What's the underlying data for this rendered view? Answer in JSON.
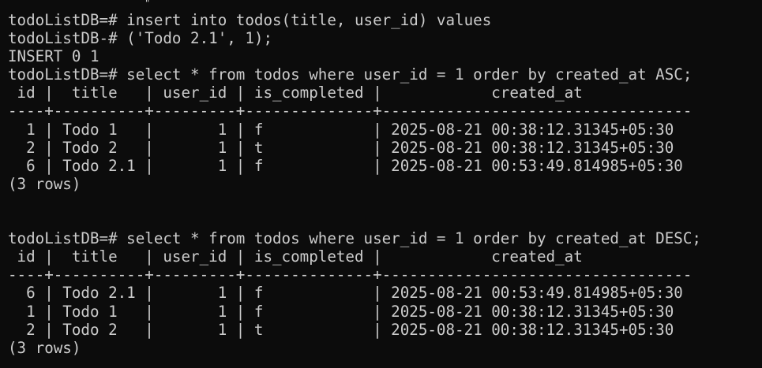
{
  "terminal": {
    "background": "#0c0c0c",
    "foreground": "#cccccc",
    "top_fragment": "\"",
    "lines": [
      "todoListDB=# insert into todos(title, user_id) values",
      "todoListDB-# ('Todo 2.1', 1);",
      "INSERT 0 1",
      "todoListDB=# select * from todos where user_id = 1 order by created_at ASC;",
      " id |  title   | user_id | is_completed |            created_at",
      "----+----------+---------+--------------+----------------------------------",
      "  1 | Todo 1   |       1 | f            | 2025-08-21 00:38:12.31345+05:30",
      "  2 | Todo 2   |       1 | t            | 2025-08-21 00:38:12.31345+05:30",
      "  6 | Todo 2.1 |       1 | f            | 2025-08-21 00:53:49.814985+05:30",
      "(3 rows)",
      "",
      "",
      "todoListDB=# select * from todos where user_id = 1 order by created_at DESC;",
      " id |  title   | user_id | is_completed |            created_at",
      "----+----------+---------+--------------+----------------------------------",
      "  6 | Todo 2.1 |       1 | f            | 2025-08-21 00:53:49.814985+05:30",
      "  1 | Todo 1   |       1 | f            | 2025-08-21 00:38:12.31345+05:30",
      "  2 | Todo 2   |       1 | t            | 2025-08-21 00:38:12.31345+05:30",
      "(3 rows)"
    ]
  }
}
